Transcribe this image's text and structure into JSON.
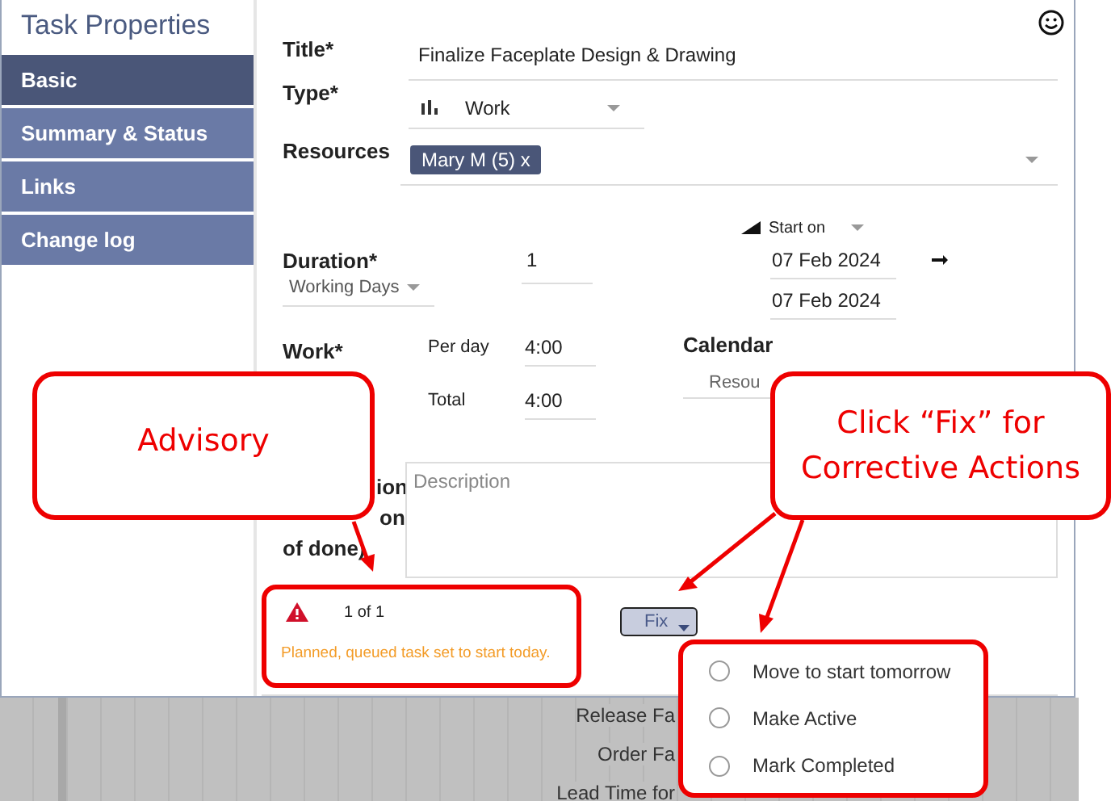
{
  "dialog": {
    "title": "Task Properties"
  },
  "sidebar": {
    "items": [
      {
        "label": "Basic",
        "selected": true
      },
      {
        "label": "Summary & Status",
        "selected": false
      },
      {
        "label": "Links",
        "selected": false
      },
      {
        "label": "Change log",
        "selected": false
      }
    ]
  },
  "form": {
    "title": {
      "label": "Title*",
      "value": "Finalize Faceplate Design & Drawing"
    },
    "type": {
      "label": "Type*",
      "value": "Work"
    },
    "resources": {
      "label": "Resources",
      "chips": [
        "Mary M (5) x"
      ]
    },
    "duration": {
      "label": "Duration*",
      "value": "1",
      "unit": "Working Days"
    },
    "dates": {
      "mode": "Start on",
      "start": "07 Feb 2024",
      "end": "07 Feb 2024"
    },
    "work": {
      "label": "Work*",
      "per_day_label": "Per day",
      "per_day": "4:00",
      "total_label": "Total",
      "total": "4:00"
    },
    "calendar": {
      "label": "Calendar",
      "value": "Resou"
    },
    "description": {
      "label_lines": [
        "ion",
        "on",
        "of done)"
      ],
      "placeholder": "Description"
    }
  },
  "advisory": {
    "counter": "1 of 1",
    "message": "Planned, queued task set to start today."
  },
  "fix_button": {
    "label": "Fix"
  },
  "fix_menu": [
    {
      "label": "Move to start tomorrow",
      "selected": false
    },
    {
      "label": "Make Active",
      "selected": false
    },
    {
      "label": "Mark Completed",
      "selected": false
    }
  ],
  "gantt": {
    "rows": [
      "Release Fa",
      "Order Fa",
      "Lead Time for"
    ]
  },
  "callouts": [
    {
      "text": "Advisory"
    },
    {
      "text": "Click “Fix” for Corrective Actions"
    }
  ]
}
